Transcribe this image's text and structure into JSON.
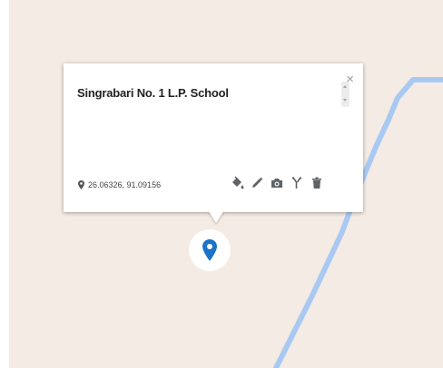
{
  "place": {
    "title": "Singrabari No. 1 L.P. School",
    "coordinates": "26.06326, 91.09156"
  },
  "icons": {
    "close": "close-icon",
    "coords": "location-pin-icon",
    "actions": [
      "paint-bucket-icon",
      "pencil-icon",
      "camera-icon",
      "directions-icon",
      "trash-icon"
    ],
    "marker": "map-marker-icon"
  },
  "colors": {
    "land": "#f3ebe4",
    "river": "#a9c9f3",
    "marker": "#1a73c8"
  },
  "close_label": "×"
}
